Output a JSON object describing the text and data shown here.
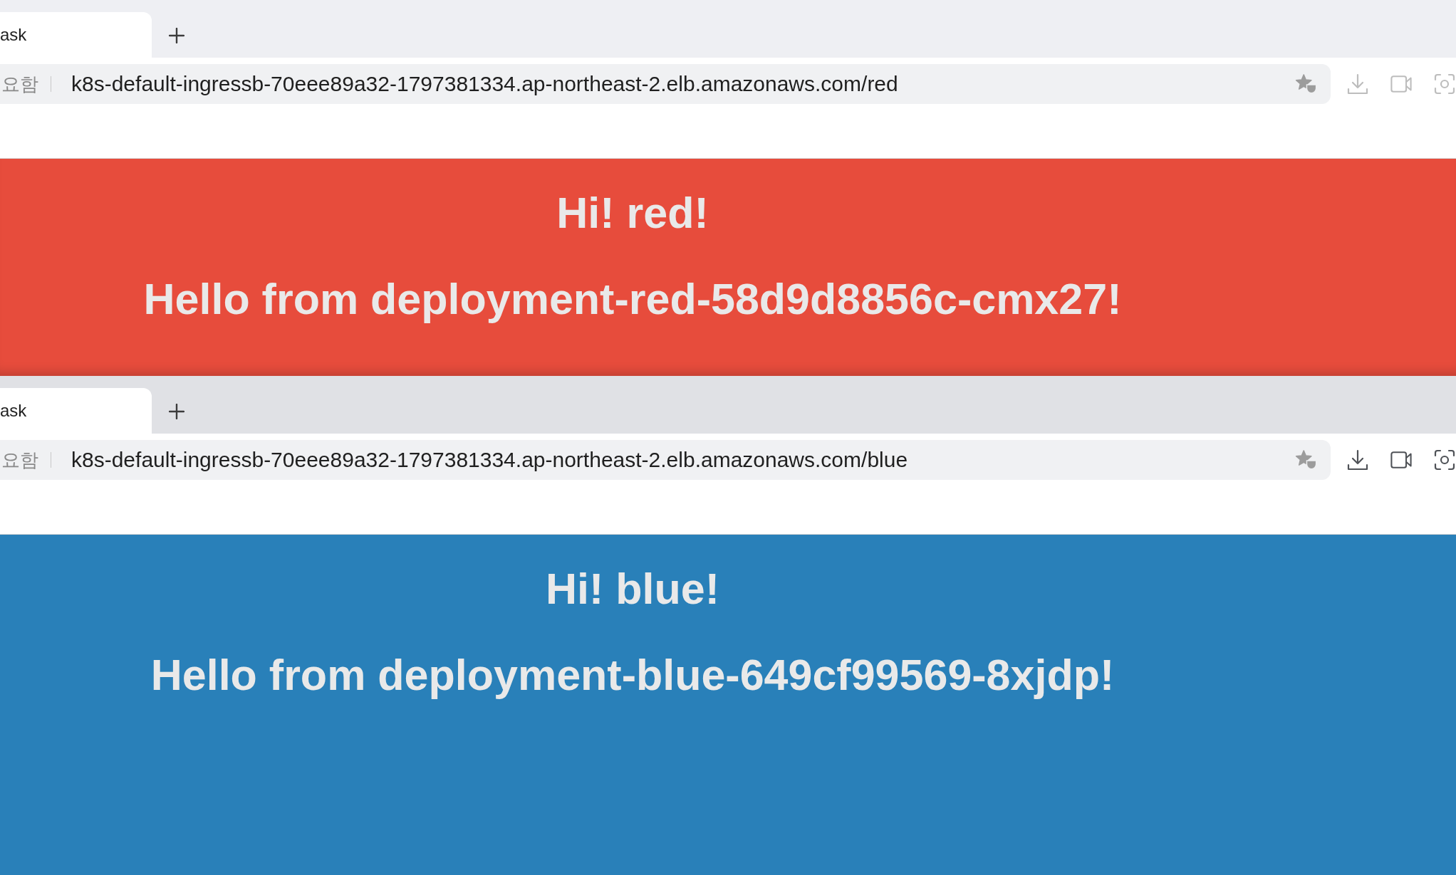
{
  "windows": [
    {
      "active": false,
      "tab": {
        "title": "ask"
      },
      "address_bar": {
        "security_label": "요함",
        "url": "k8s-default-ingressb-70eee89a32-1797381334.ap-northeast-2.elb.amazonaws.com/red"
      },
      "page": {
        "color": "#e74c3c",
        "greeting": "Hi! red!",
        "message": "Hello from deployment-red-58d9d8856c-cmx27!"
      }
    },
    {
      "active": true,
      "tab": {
        "title": "ask"
      },
      "address_bar": {
        "security_label": "요함",
        "url": "k8s-default-ingressb-70eee89a32-1797381334.ap-northeast-2.elb.amazonaws.com/blue"
      },
      "page": {
        "color": "#2980b9",
        "greeting": "Hi! blue!",
        "message": "Hello from deployment-blue-649cf99569-8xjdp!"
      }
    }
  ]
}
